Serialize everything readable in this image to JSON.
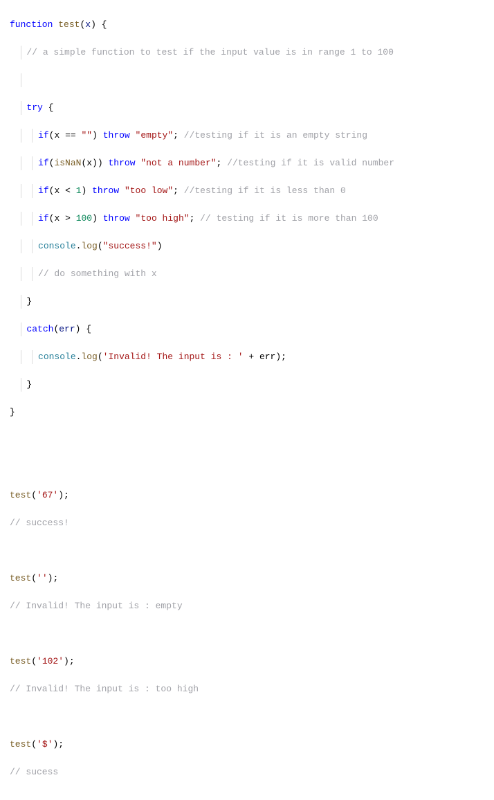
{
  "code": {
    "kw_function": "function",
    "fn_name": "test",
    "param_x": "x",
    "open_brace": "{",
    "close_brace": "}",
    "comment_desc": "// a simple function to test if the input value is in range 1 to 100",
    "kw_try": "try",
    "kw_if": "if",
    "kw_throw": "throw",
    "kw_catch": "catch",
    "cond_empty_lhs": "x",
    "op_eq": "==",
    "str_empty_1": "\"\"",
    "str_throw_empty": "\"empty\"",
    "comment_empty": "//testing if it is an empty string",
    "fn_isNaN": "isNaN",
    "str_throw_nan": "\"not a number\"",
    "comment_nan": "//testing if it is valid number",
    "op_lt": "<",
    "num_1": "1",
    "str_throw_low": "\"too low\"",
    "comment_low": "//testing if it is less than 0",
    "op_gt": ">",
    "num_100": "100",
    "str_throw_high": "\"too high\"",
    "comment_high": "// testing if it is more than 100",
    "builtin_console": "console",
    "method_log": "log",
    "str_success": "\"success!\"",
    "comment_do": "// do something with x",
    "catch_param": "err",
    "str_invalid": "'Invalid! The input is : '",
    "op_plus": "+",
    "var_err": "err",
    "call1_fn": "test",
    "call1_arg": "'67'",
    "call1_comment": "// success!",
    "call2_fn": "test",
    "call2_arg": "''",
    "call2_comment": "// Invalid! The input is : empty",
    "call3_fn": "test",
    "call3_arg": "'102'",
    "call3_comment": "// Invalid! The input is : too high",
    "call4_fn": "test",
    "call4_arg": "'$'",
    "call4_comment": "// sucess"
  }
}
